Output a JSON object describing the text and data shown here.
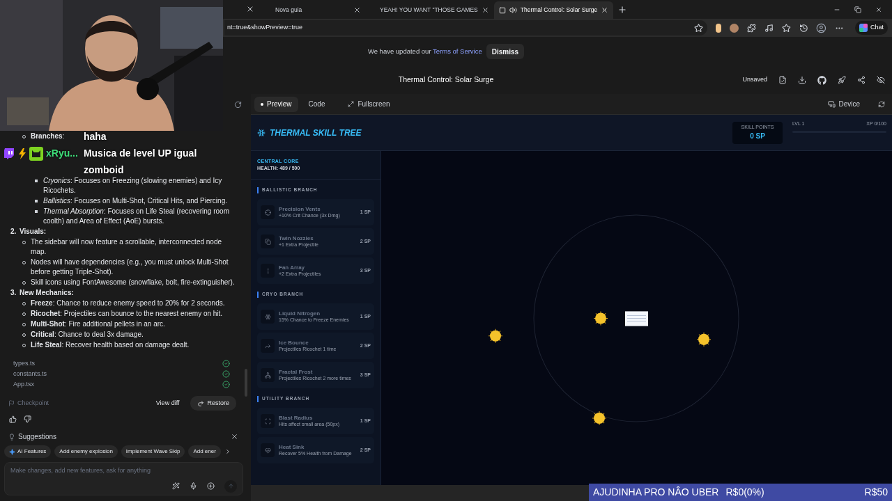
{
  "browser": {
    "tabs": [
      {
        "title": "Nova guia",
        "selected": false
      },
      {
        "title": "YEAH! YOU WANT \"THOSE GAMES",
        "selected": false
      },
      {
        "title": "Thermal Control: Solar Surge",
        "selected": true
      }
    ],
    "address": "nt=true&showPreview=true",
    "chat_button": "Chat"
  },
  "notice": {
    "text": "We have updated our",
    "link": "Terms of Service",
    "button": "Dismiss"
  },
  "app": {
    "title": "Thermal Control: Solar Surge",
    "status": "Unsaved"
  },
  "conversation": [
    {
      "kind": "sub",
      "text": "**Branches**:"
    },
    {
      "kind": "subsub",
      "text": "*Cryonics*: Focuses on Freezing (slowing enemies) and Icy Ricochets."
    },
    {
      "kind": "subsub",
      "text": "*Ballistics*: Focuses on Multi-Shot, Critical Hits, and Piercing."
    },
    {
      "kind": "subsub",
      "text": "*Thermal Absorption*: Focuses on Life Steal (recovering room coolth) and Area of Effect (AoE) bursts."
    },
    {
      "kind": "heading",
      "marker": "2.",
      "text": "**Visuals**:"
    },
    {
      "kind": "sub",
      "text": "The sidebar will now feature a scrollable, interconnected node map."
    },
    {
      "kind": "sub",
      "text": "Nodes will have dependencies (e.g., you must unlock Multi-Shot before getting Triple-Shot)."
    },
    {
      "kind": "sub",
      "text": "Skill icons using FontAwesome (snowflake, bolt, fire-extinguisher)."
    },
    {
      "kind": "heading",
      "marker": "3.",
      "text": "**New Mechanics**:"
    },
    {
      "kind": "sub",
      "text": "**Freeze**: Chance to reduce enemy speed to 20% for 2 seconds."
    },
    {
      "kind": "sub",
      "text": "**Ricochet**: Projectiles can bounce to the nearest enemy on hit."
    },
    {
      "kind": "sub",
      "text": "**Multi-Shot**: Fire additional pellets in an arc."
    },
    {
      "kind": "sub",
      "text": "**Critical**: Chance to deal 3x damage."
    },
    {
      "kind": "sub",
      "text": "**Life Steal**: Recover health based on damage dealt."
    }
  ],
  "files": [
    {
      "name": "types.ts",
      "done": true
    },
    {
      "name": "constants.ts",
      "done": true
    },
    {
      "name": "App.tsx",
      "done": true
    }
  ],
  "checkpoint": {
    "label": "Checkpoint",
    "view_diff": "View diff",
    "restore": "Restore"
  },
  "suggestions": {
    "title": "Suggestions",
    "chips": [
      {
        "label": "AI Features",
        "kind": "ai"
      },
      {
        "label": "Add enemy explosion",
        "kind": "plain"
      },
      {
        "label": "Implement Wave Skip",
        "kind": "plain"
      },
      {
        "label": "Add ener",
        "kind": "plain"
      }
    ]
  },
  "prompt": {
    "placeholder": "Make changes, add new features, ask for anything"
  },
  "preview": {
    "tabs": [
      {
        "label": "Preview",
        "selected": true
      },
      {
        "label": "Code",
        "selected": false
      }
    ],
    "fullscreen": "Fullscreen",
    "device": "Device"
  },
  "game": {
    "title": "THERMAL SKILL TREE",
    "skill_points": {
      "label": "SKILL POINTS",
      "value": "0 SP"
    },
    "lvl": "LVL 1",
    "xp": "XP 0/100",
    "xp_bar": {
      "level": 0
    },
    "core": {
      "title": "CENTRAL CORE",
      "health": "HEALTH: 489 / 500"
    },
    "branches": [
      {
        "title": "BALLISTIC BRANCH",
        "skills": [
          {
            "name": "Precision Vents",
            "desc": "+10% Crit Chance (3x Dmg)",
            "cost": "1 SP"
          },
          {
            "name": "Twin Nozzles",
            "desc": "+1 Extra Projectile",
            "cost": "2 SP"
          },
          {
            "name": "Fan Array",
            "desc": "+2 Extra Projectiles",
            "cost": "3 SP"
          }
        ]
      },
      {
        "title": "CRYO BRANCH",
        "skills": [
          {
            "name": "Liquid Nitrogen",
            "desc": "15% Chance to Freeze Enemies",
            "cost": "1 SP"
          },
          {
            "name": "Ice Bounce",
            "desc": "Projectiles Ricochet 1 time",
            "cost": "2 SP"
          },
          {
            "name": "Fractal Frost",
            "desc": "Projectiles Ricochet 2 more times",
            "cost": "3 SP"
          }
        ]
      },
      {
        "title": "UTILITY BRANCH",
        "skills": [
          {
            "name": "Blast Radius",
            "desc": "Hits affect small area (50px)",
            "cost": "1 SP"
          },
          {
            "name": "Heat Sink",
            "desc": "Recover 5% Health from Damage",
            "cost": "2 SP"
          }
        ]
      }
    ]
  },
  "stream_chat": {
    "user": "xRyu...",
    "messages": [
      "haha",
      "Musica de level UP igual zomboid"
    ]
  },
  "stream_goal": {
    "label": "AJUDINHA PRO NÂO UBER",
    "amount": "R$0(0%)",
    "goal": "R$50",
    "level": 0
  }
}
